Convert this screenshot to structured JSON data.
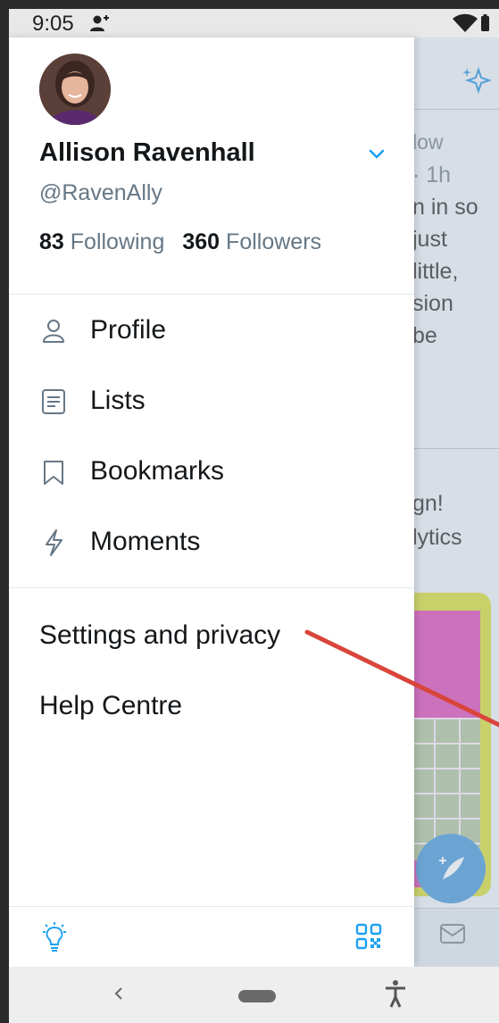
{
  "status_bar": {
    "time": "9:05"
  },
  "profile": {
    "name": "Allison Ravenhall",
    "handle": "@RavenAlly",
    "following_count": "83",
    "following_label": "Following",
    "followers_count": "360",
    "followers_label": "Followers"
  },
  "menu": {
    "items": [
      {
        "label": "Profile",
        "icon": "person-icon"
      },
      {
        "label": "Lists",
        "icon": "list-icon"
      },
      {
        "label": "Bookmarks",
        "icon": "bookmark-icon"
      },
      {
        "label": "Moments",
        "icon": "lightning-icon"
      }
    ],
    "settings_label": "Settings and privacy",
    "help_label": "Help Centre"
  },
  "background_feed": {
    "lines": [
      "low",
      "· 1h",
      "n in so",
      "just",
      "little,",
      "sion",
      "be",
      "gn!",
      "lytics"
    ]
  },
  "colors": {
    "accent": "#1da1f2",
    "annotation": "#d9453b"
  }
}
